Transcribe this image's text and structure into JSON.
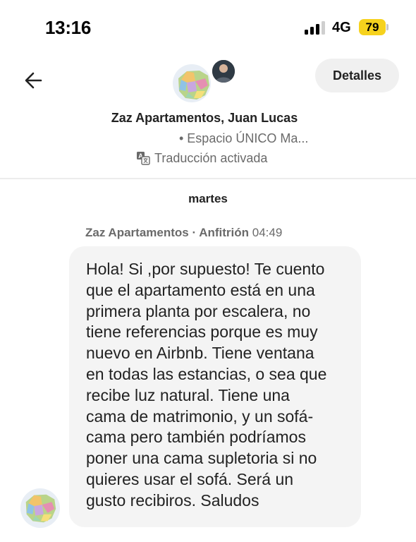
{
  "status_bar": {
    "time": "13:16",
    "network": "4G",
    "battery": "79",
    "battery_color": "#f6d21d"
  },
  "header": {
    "back_icon": "arrow-left-icon",
    "details_label": "Detalles",
    "title": "Zaz Apartamentos, Juan Lucas",
    "subtitle": "• Espacio ÚNICO Ma...",
    "translation_icon": "translate-icon",
    "translation_label": "Traducción activada"
  },
  "conversation": {
    "day_label": "martes",
    "message": {
      "sender": "Zaz Apartamentos · Anfitrión",
      "time": "04:49",
      "lines": [
        "Hola! Si ,por supuesto! Te cuento",
        "que el apartamento está en una",
        "primera planta por escalera, no",
        "tiene referencias porque es muy",
        "nuevo en Airbnb. Tiene ventana",
        "en todas las estancias, o sea que",
        "recibe luz natural. Tiene una",
        "cama de matrimonio, y un sofá-",
        "cama pero también podríamos",
        "poner una cama supletoria si no",
        "quieres usar el sofá. Será un",
        "gusto recibiros. Saludos"
      ]
    }
  }
}
